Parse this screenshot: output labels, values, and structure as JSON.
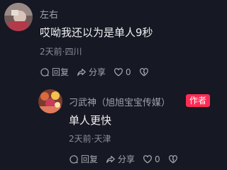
{
  "main_comment": {
    "username": "左右",
    "text": "哎呦我还以为是单人9秒",
    "meta": "2天前·四川",
    "reply_label": "回复",
    "share_label": "分享",
    "like_count": "0"
  },
  "reply_comment": {
    "username": "刁武神（旭旭宝宝传媒）",
    "author_badge": "作者",
    "text": "单人更快",
    "meta": "2天前·天津",
    "reply_label": "回复",
    "share_label": "分享",
    "like_count": "0"
  },
  "colors": {
    "background": "#161823",
    "badge": "#fe2c55"
  },
  "icons": [
    "reply-icon",
    "share-icon",
    "heart-icon",
    "dislike-icon"
  ]
}
